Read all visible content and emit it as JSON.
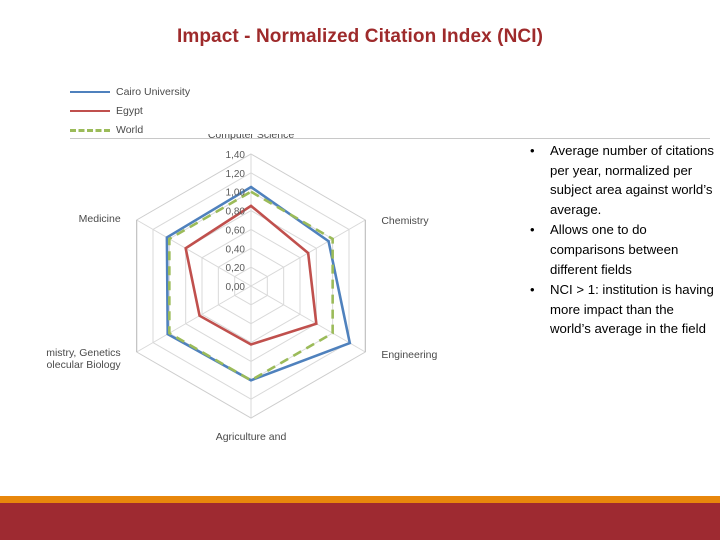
{
  "slide": {
    "title": "Impact - Normalized Citation Index (NCI)"
  },
  "colors": {
    "title": "#9e2a2b",
    "cairo": "#4f81bd",
    "egypt": "#c0504d",
    "world": "#9bbb59",
    "footer_orange": "#e8870c",
    "footer_red": "#9e2a31"
  },
  "bullets": [
    {
      "marker": "•",
      "text": "Average number of citations per year, normalized per subject area against world’s average."
    },
    {
      "marker": "•",
      "text": "Allows one to do comparisons between different fields"
    },
    {
      "marker": "•",
      "text": "NCI > 1: institution is having more impact than the world’s average in the field"
    }
  ],
  "footer": {
    "orange_bar": "orange-accent-bar",
    "red_bar": "red-accent-bar"
  },
  "chart_data": {
    "type": "radar",
    "title": "Impact - Normalized Citation Index (NCI)",
    "categories": [
      "Computer Science",
      "Chemistry",
      "Engineering",
      "Agriculture and Biological Sciences",
      "Biochemistry, Genetics and Molecular Biology",
      "Medicine"
    ],
    "tick_labels": [
      "0,00",
      "0,20",
      "0,40",
      "0,60",
      "0,80",
      "1,00",
      "1,20",
      "1,40"
    ],
    "tick_values": [
      0.0,
      0.2,
      0.4,
      0.6,
      0.8,
      1.0,
      1.2,
      1.4
    ],
    "rlim": [
      0.0,
      1.4
    ],
    "grid": true,
    "legend_position": "top-left",
    "series": [
      {
        "name": "Cairo University",
        "color": "#4f81bd",
        "style": "solid",
        "values": [
          1.05,
          0.95,
          1.21,
          1.0,
          1.02,
          1.03
        ]
      },
      {
        "name": "Egypt",
        "color": "#c0504d",
        "style": "solid",
        "values": [
          0.85,
          0.7,
          0.8,
          0.62,
          0.63,
          0.8
        ]
      },
      {
        "name": "World",
        "color": "#9bbb59",
        "style": "dashed",
        "values": [
          1.0,
          1.0,
          1.0,
          1.0,
          1.0,
          1.0
        ]
      }
    ]
  }
}
